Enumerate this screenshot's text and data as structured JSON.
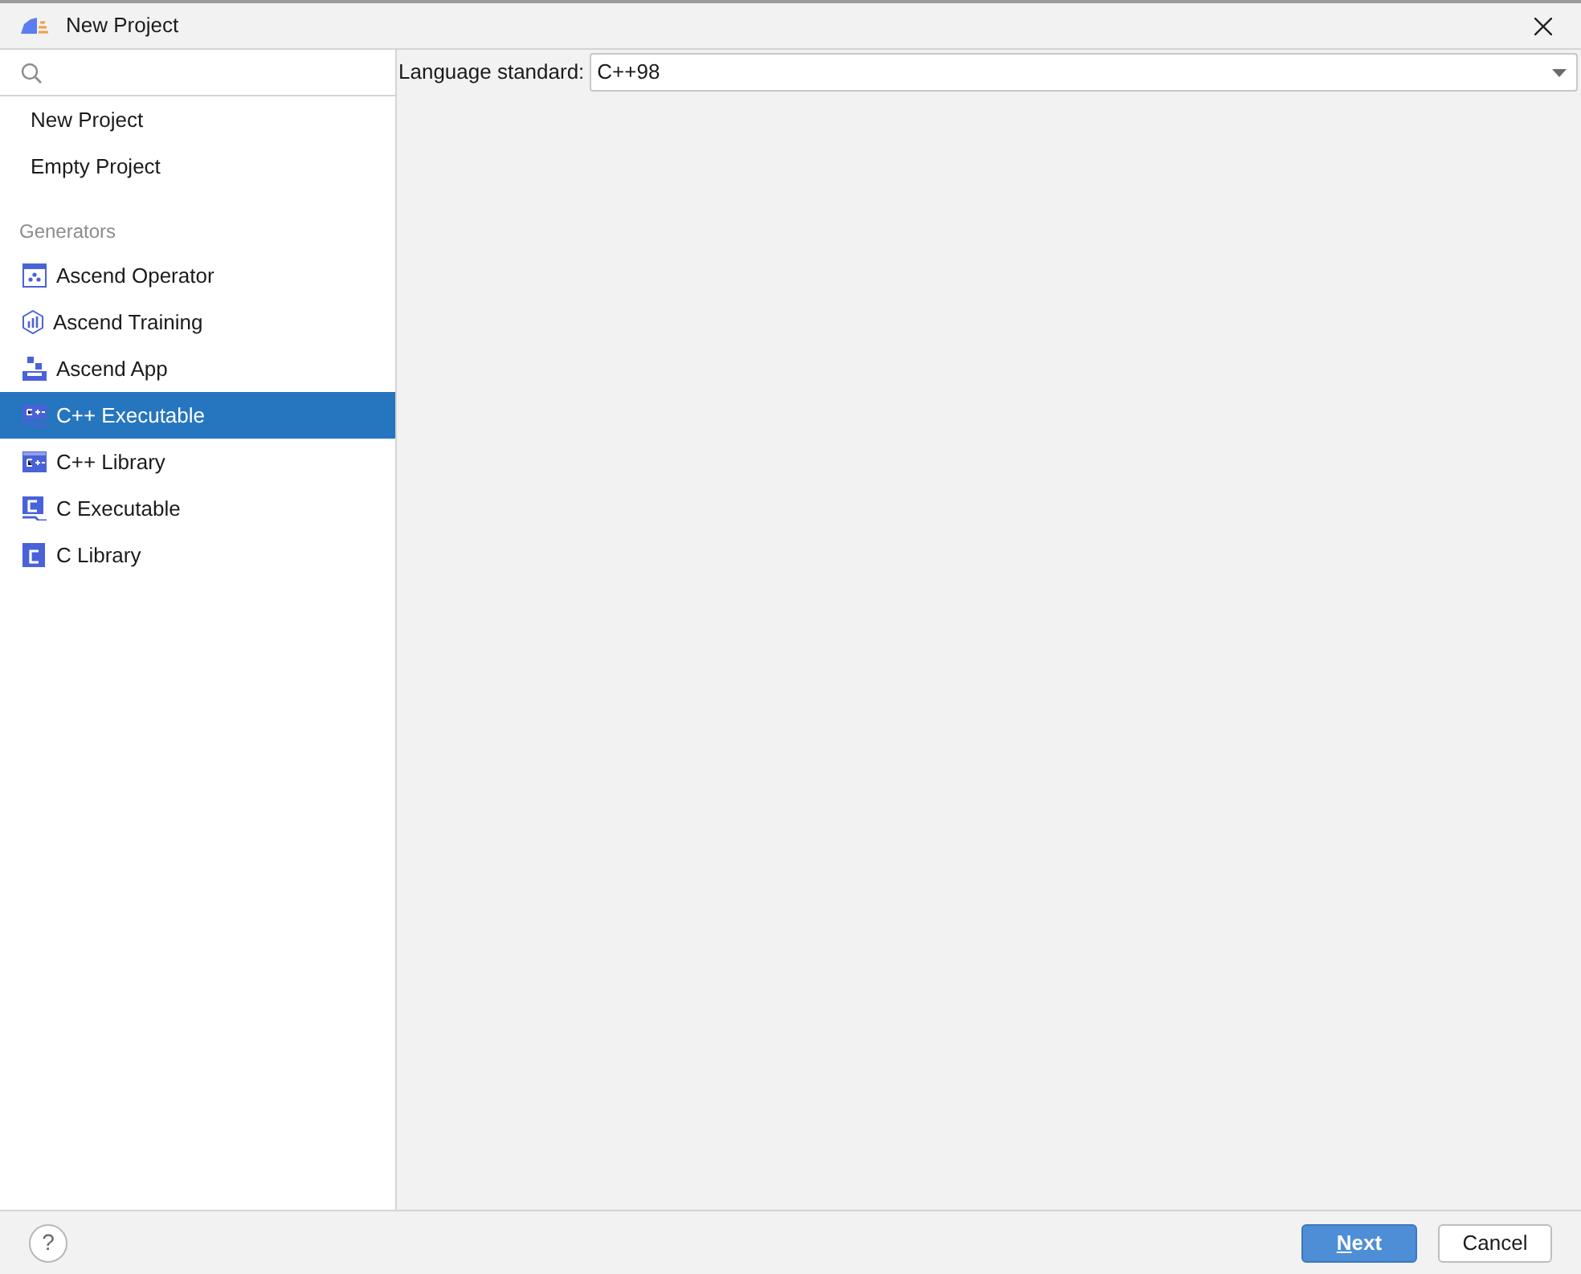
{
  "window": {
    "title": "New Project"
  },
  "sidebar": {
    "items": [
      {
        "label": "New Project",
        "selected": false
      },
      {
        "label": "Empty Project",
        "selected": false
      }
    ],
    "section": "Generators",
    "generators": [
      {
        "label": "Ascend Operator",
        "selected": false
      },
      {
        "label": "Ascend Training",
        "selected": false
      },
      {
        "label": "Ascend App",
        "selected": false
      },
      {
        "label": "C++ Executable",
        "selected": true
      },
      {
        "label": "C++ Library",
        "selected": false
      },
      {
        "label": "C Executable",
        "selected": false
      },
      {
        "label": "C Library",
        "selected": false
      }
    ]
  },
  "settings": {
    "label": "Language standard:",
    "value": "C++98"
  },
  "footer": {
    "help": "?",
    "buttons": [
      {
        "label": "Next",
        "kind": "primary",
        "mnemonic": true
      },
      {
        "label": "Cancel",
        "kind": "secondary",
        "mnemonic": false
      }
    ]
  }
}
